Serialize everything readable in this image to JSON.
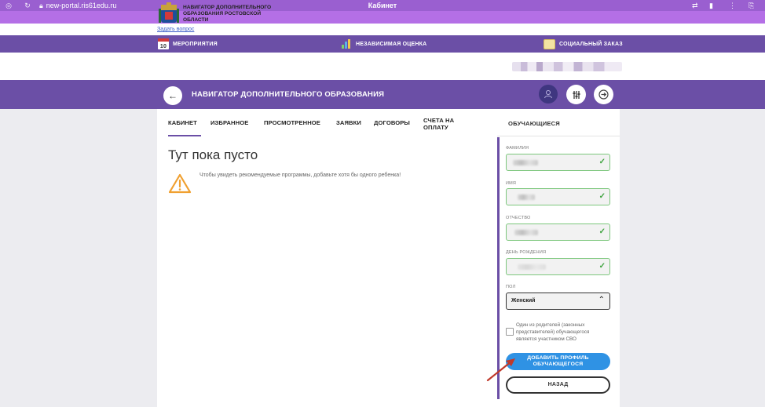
{
  "browser": {
    "url": "new-portal.ris61edu.ru",
    "window_title": "Кабинет"
  },
  "ask_link": "Задать вопрос",
  "top_menu": {
    "events_day": "10",
    "events": "МЕРОПРИЯТИЯ",
    "assessment": "НЕЗАВИСИМАЯ ОЦЕНКА",
    "social_order": "СОЦИАЛЬНЫЙ ЗАКАЗ"
  },
  "logo_text": "НАВИГАТОР ДОПОЛНИТЕЛЬНОГО ОБРАЗОВАНИЯ РОСТОВСКОЙ ОБЛАСТИ",
  "header": {
    "title": "НАВИГАТОР ДОПОЛНИТЕЛЬНОГО ОБРАЗОВАНИЯ"
  },
  "tabs": [
    {
      "label": "КАБИНЕТ",
      "active": true
    },
    {
      "label": "ИЗБРАННОЕ"
    },
    {
      "label": "ПРОСМОТРЕННОЕ"
    },
    {
      "label": "ЗАЯВКИ"
    },
    {
      "label": "ДОГОВОРЫ"
    },
    {
      "label": "СЧЕТА НА ОПЛАТУ"
    }
  ],
  "main": {
    "empty_title": "Тут пока пусто",
    "empty_text": "Чтобы увидеть рекомендуемые программы, добавьте хотя бы одного ребенка!"
  },
  "side": {
    "title": "ОБУЧАЮЩИЕСЯ",
    "fields": {
      "lastname_label": "ФАМИЛИЯ",
      "firstname_label": "ИМЯ",
      "patronymic_label": "ОТЧЕСТВО",
      "birthday_label": "ДЕНЬ РОЖДЕНИЯ",
      "gender_label": "ПОЛ",
      "gender_value": "Женский"
    },
    "svo_checkbox_label": "Один из родителей (законных представителей) обучающегося является участником СВО",
    "add_button": "ДОБАВИТЬ ПРОФИЛЬ ОБУЧАЮЩЕГОСЯ",
    "back_button": "НАЗАД"
  },
  "colors": {
    "brand_purple": "#6b4fa6",
    "browser_purple": "#9a5fd0",
    "valid_green": "#7cc77c",
    "primary_blue": "#2f92e4",
    "arrow_red": "#c0392b"
  }
}
